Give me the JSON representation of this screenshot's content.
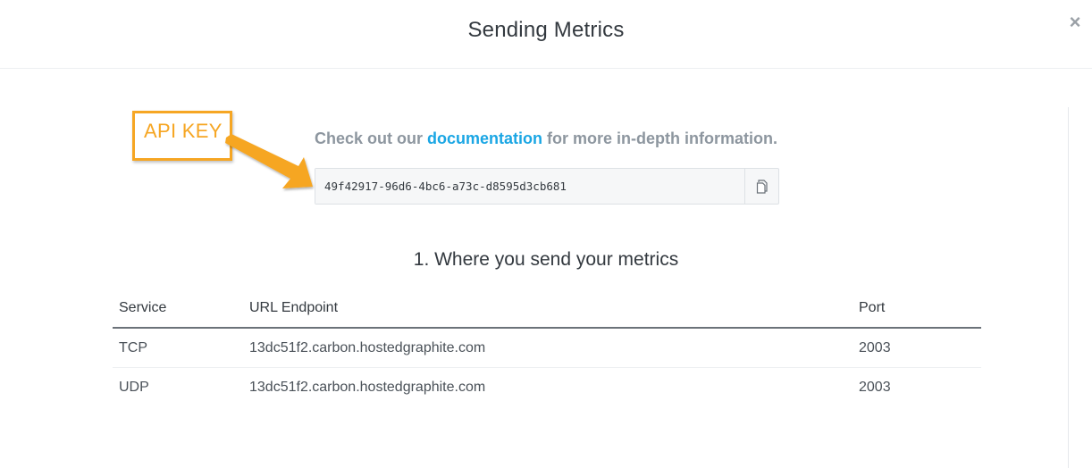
{
  "modal": {
    "title": "Sending Metrics",
    "close_label": "×"
  },
  "annotation": {
    "label": "API KEY",
    "color": "#f6a623"
  },
  "intro": {
    "prefix": "Check out our ",
    "link_text": "documentation",
    "suffix": " for more in-depth information."
  },
  "api_key": {
    "value": "49f42917-96d6-4bc6-a73c-d8595d3cb681",
    "copy_icon": "copy-icon"
  },
  "section": {
    "title": "1. Where you send your metrics"
  },
  "table": {
    "headers": [
      "Service",
      "URL Endpoint",
      "Port"
    ],
    "rows": [
      [
        "TCP",
        "13dc51f2.carbon.hostedgraphite.com",
        "2003"
      ],
      [
        "UDP",
        "13dc51f2.carbon.hostedgraphite.com",
        "2003"
      ]
    ]
  },
  "colors": {
    "link": "#1aa6e4",
    "muted_text": "#8d969f"
  }
}
